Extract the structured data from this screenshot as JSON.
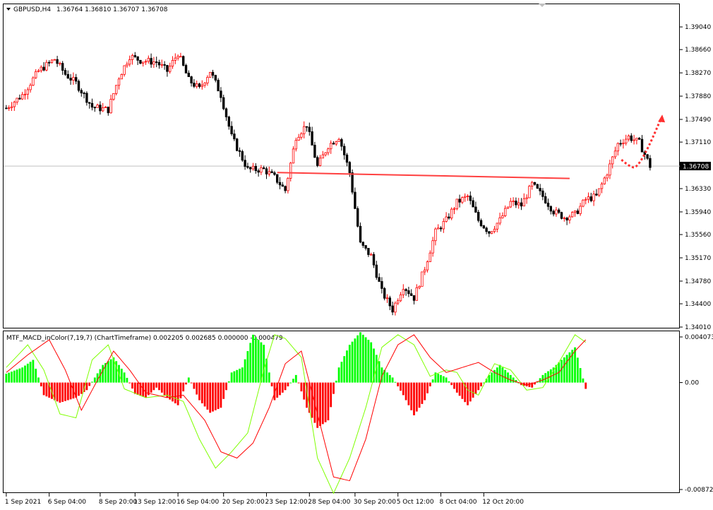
{
  "main_header": {
    "symbol": "GBPUSD,H4",
    "ohlc": "1.36764 1.36810 1.36707 1.36708"
  },
  "indicator_header": {
    "title": "MTF_MACD_inColor(7,19,7) (ChartTimeframe) 0.002205 0.002685 0.000000 -0.000479"
  },
  "colors": {
    "bull_candle": "#ff0000",
    "bear_candle": "#000000",
    "hist_positive": "#00ff00",
    "hist_negative": "#ff0000",
    "macd_line": "#7fff00",
    "signal_line": "#ff0000",
    "support_line": "#ff4040",
    "arrow": "#ff3030",
    "grid_border": "#000000"
  },
  "chart_data": [
    {
      "type": "candlestick",
      "title": "GBPUSD,H4",
      "ylim": [
        1.3401,
        1.3942
      ],
      "y_ticks": [
        "1.39040",
        "1.38660",
        "1.38270",
        "1.37880",
        "1.37490",
        "1.37110",
        "1.36708",
        "1.36330",
        "1.35940",
        "1.35560",
        "1.35170",
        "1.34780",
        "1.34400",
        "1.34010"
      ],
      "current_price_label": "1.36708",
      "current_price": 1.36708,
      "x_tick_labels": [
        "1 Sep 2021",
        "6 Sep 04:00",
        "8 Sep 20:00",
        "13 Sep 12:00",
        "16 Sep 04:00",
        "20 Sep 20:00",
        "23 Sep 12:00",
        "28 Sep 04:00",
        "30 Sep 20:00",
        "5 Oct 12:00",
        "8 Oct 04:00",
        "12 Oct 20:00"
      ],
      "close_path": [
        [
          0,
          1.3768
        ],
        [
          6,
          1.379
        ],
        [
          12,
          1.383
        ],
        [
          18,
          1.385
        ],
        [
          22,
          1.3825
        ],
        [
          26,
          1.381
        ],
        [
          32,
          1.377
        ],
        [
          38,
          1.3765
        ],
        [
          42,
          1.382
        ],
        [
          46,
          1.3855
        ],
        [
          50,
          1.3848
        ],
        [
          56,
          1.3845
        ],
        [
          60,
          1.383
        ],
        [
          64,
          1.386
        ],
        [
          68,
          1.3815
        ],
        [
          72,
          1.38
        ],
        [
          76,
          1.383
        ],
        [
          80,
          1.379
        ],
        [
          84,
          1.372
        ],
        [
          90,
          1.3665
        ],
        [
          96,
          1.3665
        ],
        [
          100,
          1.3652
        ],
        [
          104,
          1.363
        ],
        [
          108,
          1.372
        ],
        [
          112,
          1.374
        ],
        [
          116,
          1.367
        ],
        [
          120,
          1.3705
        ],
        [
          124,
          1.372
        ],
        [
          128,
          1.366
        ],
        [
          132,
          1.354
        ],
        [
          136,
          1.352
        ],
        [
          140,
          1.346
        ],
        [
          144,
          1.343
        ],
        [
          148,
          1.347
        ],
        [
          152,
          1.345
        ],
        [
          156,
          1.35
        ],
        [
          160,
          1.356
        ],
        [
          164,
          1.358
        ],
        [
          168,
          1.361
        ],
        [
          172,
          1.362
        ],
        [
          176,
          1.358
        ],
        [
          180,
          1.356
        ],
        [
          184,
          1.358
        ],
        [
          188,
          1.361
        ],
        [
          192,
          1.3605
        ],
        [
          196,
          1.364
        ],
        [
          200,
          1.362
        ],
        [
          204,
          1.3595
        ],
        [
          208,
          1.3585
        ],
        [
          212,
          1.359
        ],
        [
          216,
          1.3615
        ],
        [
          220,
          1.362
        ],
        [
          224,
          1.366
        ],
        [
          228,
          1.3708
        ],
        [
          232,
          1.372
        ],
        [
          236,
          1.371
        ],
        [
          240,
          1.36708
        ]
      ],
      "support_line": {
        "from": [
          101,
          1.366
        ],
        "to": [
          210,
          1.365
        ]
      },
      "forecast_arrow": {
        "from": [
          233,
          1.3672
        ],
        "to": [
          244,
          1.375
        ]
      }
    },
    {
      "type": "bar",
      "title": "MTF_MACD_inColor(7,19,7)",
      "ylim": [
        -0.008721,
        0.004073
      ],
      "y_ticks": [
        "0.004073",
        "0.00",
        "-0.008721"
      ],
      "histogram_path": [
        [
          0,
          0.0007
        ],
        [
          6,
          0.0012
        ],
        [
          10,
          0.0018
        ],
        [
          14,
          -0.001
        ],
        [
          20,
          -0.0016
        ],
        [
          26,
          -0.0012
        ],
        [
          30,
          -0.0006
        ],
        [
          36,
          0.0014
        ],
        [
          40,
          0.002
        ],
        [
          44,
          0.0008
        ],
        [
          48,
          -0.0009
        ],
        [
          52,
          -0.0012
        ],
        [
          56,
          -0.0004
        ],
        [
          60,
          -0.0012
        ],
        [
          64,
          -0.0018
        ],
        [
          68,
          0.0004
        ],
        [
          72,
          -0.0014
        ],
        [
          76,
          -0.0024
        ],
        [
          80,
          -0.002
        ],
        [
          84,
          0.0008
        ],
        [
          88,
          0.0012
        ],
        [
          92,
          0.0038
        ],
        [
          96,
          0.003
        ],
        [
          100,
          -0.0014
        ],
        [
          104,
          -0.0006
        ],
        [
          108,
          0.0006
        ],
        [
          112,
          -0.002
        ],
        [
          116,
          -0.0036
        ],
        [
          120,
          -0.003
        ],
        [
          124,
          0.0012
        ],
        [
          128,
          0.003
        ],
        [
          132,
          0.004
        ],
        [
          136,
          0.0032
        ],
        [
          140,
          0.0012
        ],
        [
          144,
          0.0004
        ],
        [
          148,
          -0.001
        ],
        [
          152,
          -0.0026
        ],
        [
          156,
          -0.0014
        ],
        [
          160,
          0.0008
        ],
        [
          164,
          0.0004
        ],
        [
          168,
          -0.0008
        ],
        [
          172,
          -0.0018
        ],
        [
          176,
          -0.0006
        ],
        [
          180,
          0.0006
        ],
        [
          184,
          0.0014
        ],
        [
          188,
          0.0006
        ],
        [
          192,
          -0.0002
        ],
        [
          196,
          -0.0004
        ],
        [
          200,
          0.0006
        ],
        [
          204,
          0.0012
        ],
        [
          208,
          0.002
        ],
        [
          212,
          0.0028
        ],
        [
          216,
          -0.0005
        ]
      ],
      "macd_line_path": [
        [
          0,
          0.0012
        ],
        [
          8,
          0.003
        ],
        [
          14,
          0.001
        ],
        [
          20,
          -0.0025
        ],
        [
          26,
          -0.0028
        ],
        [
          32,
          0.0018
        ],
        [
          38,
          0.003
        ],
        [
          44,
          -0.0005
        ],
        [
          52,
          -0.0012
        ],
        [
          60,
          -0.001
        ],
        [
          66,
          -0.0015
        ],
        [
          72,
          -0.0045
        ],
        [
          78,
          -0.0068
        ],
        [
          84,
          -0.0055
        ],
        [
          90,
          -0.004
        ],
        [
          96,
          0.001
        ],
        [
          100,
          0.0038
        ],
        [
          104,
          0.0035
        ],
        [
          110,
          0.002
        ],
        [
          116,
          -0.006
        ],
        [
          122,
          -0.0088
        ],
        [
          128,
          -0.006
        ],
        [
          134,
          -0.002
        ],
        [
          140,
          0.0028
        ],
        [
          146,
          0.0038
        ],
        [
          152,
          0.003
        ],
        [
          158,
          0.0005
        ],
        [
          164,
          0.001
        ],
        [
          168,
          0.0008
        ],
        [
          172,
          -0.0006
        ],
        [
          176,
          -0.001
        ],
        [
          182,
          0.0015
        ],
        [
          188,
          0.001
        ],
        [
          194,
          -0.0006
        ],
        [
          200,
          -0.0004
        ],
        [
          206,
          0.0016
        ],
        [
          212,
          0.0038
        ],
        [
          216,
          0.0032
        ]
      ],
      "signal_line_path": [
        [
          0,
          0.0008
        ],
        [
          8,
          0.0022
        ],
        [
          16,
          0.0034
        ],
        [
          22,
          0.001
        ],
        [
          28,
          -0.0022
        ],
        [
          34,
          0.0002
        ],
        [
          40,
          0.0025
        ],
        [
          46,
          0.001
        ],
        [
          52,
          -0.0008
        ],
        [
          60,
          -0.0012
        ],
        [
          66,
          -0.001
        ],
        [
          74,
          -0.003
        ],
        [
          80,
          -0.0055
        ],
        [
          86,
          -0.006
        ],
        [
          92,
          -0.0048
        ],
        [
          98,
          -0.002
        ],
        [
          104,
          0.0015
        ],
        [
          110,
          0.0025
        ],
        [
          116,
          -0.0025
        ],
        [
          122,
          -0.0075
        ],
        [
          128,
          -0.0078
        ],
        [
          134,
          -0.0045
        ],
        [
          140,
          0.0005
        ],
        [
          146,
          0.003
        ],
        [
          152,
          0.0038
        ],
        [
          158,
          0.002
        ],
        [
          164,
          0.0008
        ],
        [
          170,
          0.0012
        ],
        [
          176,
          0.0016
        ],
        [
          182,
          0.0008
        ],
        [
          188,
          0.0002
        ],
        [
          194,
          -0.0002
        ],
        [
          200,
          0.0002
        ],
        [
          206,
          0.0008
        ],
        [
          212,
          0.0025
        ],
        [
          216,
          0.0034
        ]
      ]
    }
  ]
}
